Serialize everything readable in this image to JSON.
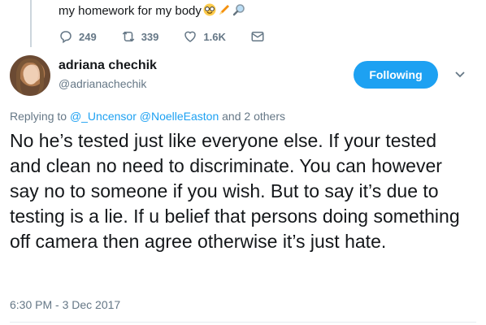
{
  "parent_tweet": {
    "text": "my homework for my body",
    "emojis": [
      "nerd-face",
      "pencil",
      "magnifying-glass"
    ],
    "actions": {
      "replies": "249",
      "retweets": "339",
      "likes": "1.6K"
    }
  },
  "author": {
    "name": "adriana chechik",
    "handle": "@adrianachechik",
    "follow_label": "Following"
  },
  "reply_context": {
    "prefix": "Replying to",
    "user1": "@_Uncensor",
    "user2": "@NoelleEaston",
    "suffix": "and 2 others"
  },
  "tweet": {
    "text": "No he’s tested just like everyone else. If your tested and clean no need to discriminate. You can however say no to someone if you wish. But to say it’s due to testing is a lie. If u belief that persons doing something off camera then agree otherwise it’s just hate.",
    "timestamp": "6:30 PM - 3 Dec 2017"
  },
  "colors": {
    "accent": "#1da1f2",
    "secondary_text": "#657786",
    "primary_text": "#14171a"
  }
}
